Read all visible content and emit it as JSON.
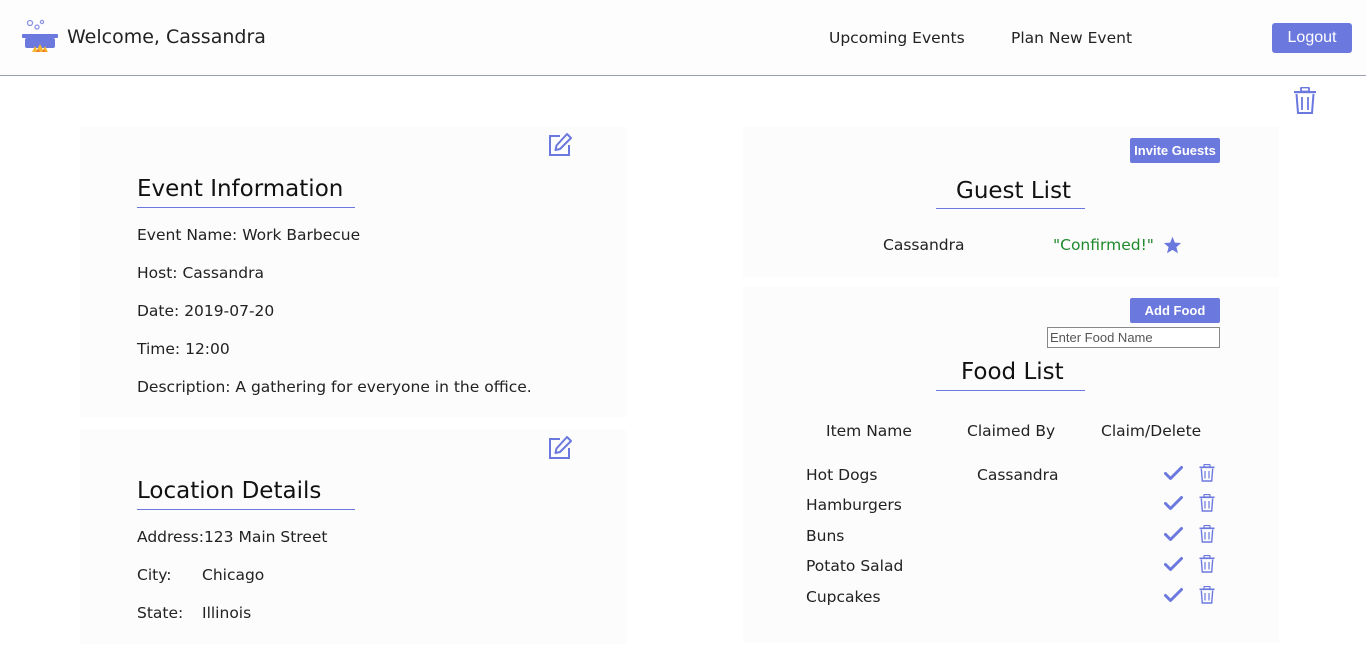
{
  "header": {
    "welcome": "Welcome, Cassandra",
    "nav": [
      "Upcoming Events",
      "Plan New Event"
    ],
    "logout_label": "Logout"
  },
  "event_info": {
    "title": "Event Information",
    "name_line": "Event Name: Work Barbecue",
    "host_line": "Host: Cassandra",
    "date_line": "Date: 2019-07-20",
    "time_line": "Time: 12:00",
    "description_line": "Description: A gathering for everyone in the office."
  },
  "location": {
    "title": "Location Details",
    "address_line": "Address:123 Main Street",
    "city_label": "City:",
    "city_value": "Chicago",
    "state_label": "State:",
    "state_value": "Illinois"
  },
  "guests": {
    "invite_label": "Invite Guests",
    "title": "Guest List",
    "rows": [
      {
        "name": "Cassandra",
        "status": "\"Confirmed!\"",
        "icon": "star-icon"
      }
    ]
  },
  "food": {
    "add_label": "Add Food",
    "input_placeholder": "Enter Food Name",
    "title": "Food List",
    "columns": [
      "Item Name",
      "Claimed By",
      "Claim/Delete"
    ],
    "items": [
      {
        "name": "Hot Dogs",
        "claimed_by": "Cassandra"
      },
      {
        "name": "Hamburgers",
        "claimed_by": ""
      },
      {
        "name": "Buns",
        "claimed_by": ""
      },
      {
        "name": "Potato Salad",
        "claimed_by": ""
      },
      {
        "name": "Cupcakes",
        "claimed_by": ""
      }
    ]
  },
  "colors": {
    "accent": "#6b78de",
    "confirmed": "#1f8a2c"
  }
}
